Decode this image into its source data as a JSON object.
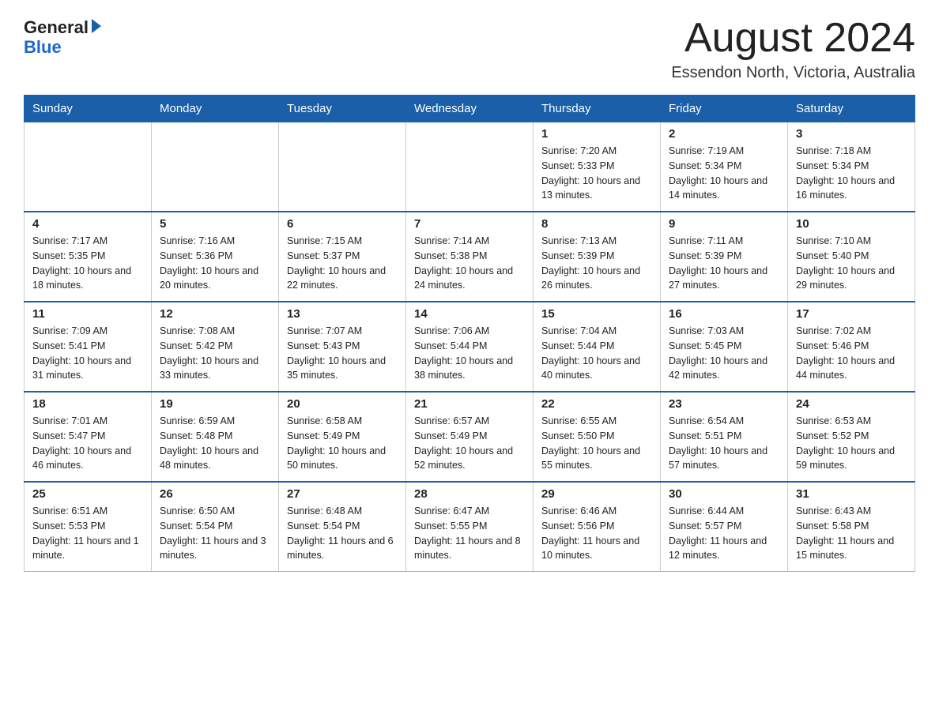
{
  "header": {
    "logo": {
      "general": "General",
      "blue": "Blue",
      "triangle": "▶"
    },
    "title": "August 2024",
    "location": "Essendon North, Victoria, Australia"
  },
  "calendar": {
    "days_of_week": [
      "Sunday",
      "Monday",
      "Tuesday",
      "Wednesday",
      "Thursday",
      "Friday",
      "Saturday"
    ],
    "weeks": [
      [
        {
          "day": "",
          "info": ""
        },
        {
          "day": "",
          "info": ""
        },
        {
          "day": "",
          "info": ""
        },
        {
          "day": "",
          "info": ""
        },
        {
          "day": "1",
          "info": "Sunrise: 7:20 AM\nSunset: 5:33 PM\nDaylight: 10 hours and 13 minutes."
        },
        {
          "day": "2",
          "info": "Sunrise: 7:19 AM\nSunset: 5:34 PM\nDaylight: 10 hours and 14 minutes."
        },
        {
          "day": "3",
          "info": "Sunrise: 7:18 AM\nSunset: 5:34 PM\nDaylight: 10 hours and 16 minutes."
        }
      ],
      [
        {
          "day": "4",
          "info": "Sunrise: 7:17 AM\nSunset: 5:35 PM\nDaylight: 10 hours and 18 minutes."
        },
        {
          "day": "5",
          "info": "Sunrise: 7:16 AM\nSunset: 5:36 PM\nDaylight: 10 hours and 20 minutes."
        },
        {
          "day": "6",
          "info": "Sunrise: 7:15 AM\nSunset: 5:37 PM\nDaylight: 10 hours and 22 minutes."
        },
        {
          "day": "7",
          "info": "Sunrise: 7:14 AM\nSunset: 5:38 PM\nDaylight: 10 hours and 24 minutes."
        },
        {
          "day": "8",
          "info": "Sunrise: 7:13 AM\nSunset: 5:39 PM\nDaylight: 10 hours and 26 minutes."
        },
        {
          "day": "9",
          "info": "Sunrise: 7:11 AM\nSunset: 5:39 PM\nDaylight: 10 hours and 27 minutes."
        },
        {
          "day": "10",
          "info": "Sunrise: 7:10 AM\nSunset: 5:40 PM\nDaylight: 10 hours and 29 minutes."
        }
      ],
      [
        {
          "day": "11",
          "info": "Sunrise: 7:09 AM\nSunset: 5:41 PM\nDaylight: 10 hours and 31 minutes."
        },
        {
          "day": "12",
          "info": "Sunrise: 7:08 AM\nSunset: 5:42 PM\nDaylight: 10 hours and 33 minutes."
        },
        {
          "day": "13",
          "info": "Sunrise: 7:07 AM\nSunset: 5:43 PM\nDaylight: 10 hours and 35 minutes."
        },
        {
          "day": "14",
          "info": "Sunrise: 7:06 AM\nSunset: 5:44 PM\nDaylight: 10 hours and 38 minutes."
        },
        {
          "day": "15",
          "info": "Sunrise: 7:04 AM\nSunset: 5:44 PM\nDaylight: 10 hours and 40 minutes."
        },
        {
          "day": "16",
          "info": "Sunrise: 7:03 AM\nSunset: 5:45 PM\nDaylight: 10 hours and 42 minutes."
        },
        {
          "day": "17",
          "info": "Sunrise: 7:02 AM\nSunset: 5:46 PM\nDaylight: 10 hours and 44 minutes."
        }
      ],
      [
        {
          "day": "18",
          "info": "Sunrise: 7:01 AM\nSunset: 5:47 PM\nDaylight: 10 hours and 46 minutes."
        },
        {
          "day": "19",
          "info": "Sunrise: 6:59 AM\nSunset: 5:48 PM\nDaylight: 10 hours and 48 minutes."
        },
        {
          "day": "20",
          "info": "Sunrise: 6:58 AM\nSunset: 5:49 PM\nDaylight: 10 hours and 50 minutes."
        },
        {
          "day": "21",
          "info": "Sunrise: 6:57 AM\nSunset: 5:49 PM\nDaylight: 10 hours and 52 minutes."
        },
        {
          "day": "22",
          "info": "Sunrise: 6:55 AM\nSunset: 5:50 PM\nDaylight: 10 hours and 55 minutes."
        },
        {
          "day": "23",
          "info": "Sunrise: 6:54 AM\nSunset: 5:51 PM\nDaylight: 10 hours and 57 minutes."
        },
        {
          "day": "24",
          "info": "Sunrise: 6:53 AM\nSunset: 5:52 PM\nDaylight: 10 hours and 59 minutes."
        }
      ],
      [
        {
          "day": "25",
          "info": "Sunrise: 6:51 AM\nSunset: 5:53 PM\nDaylight: 11 hours and 1 minute."
        },
        {
          "day": "26",
          "info": "Sunrise: 6:50 AM\nSunset: 5:54 PM\nDaylight: 11 hours and 3 minutes."
        },
        {
          "day": "27",
          "info": "Sunrise: 6:48 AM\nSunset: 5:54 PM\nDaylight: 11 hours and 6 minutes."
        },
        {
          "day": "28",
          "info": "Sunrise: 6:47 AM\nSunset: 5:55 PM\nDaylight: 11 hours and 8 minutes."
        },
        {
          "day": "29",
          "info": "Sunrise: 6:46 AM\nSunset: 5:56 PM\nDaylight: 11 hours and 10 minutes."
        },
        {
          "day": "30",
          "info": "Sunrise: 6:44 AM\nSunset: 5:57 PM\nDaylight: 11 hours and 12 minutes."
        },
        {
          "day": "31",
          "info": "Sunrise: 6:43 AM\nSunset: 5:58 PM\nDaylight: 11 hours and 15 minutes."
        }
      ]
    ]
  }
}
